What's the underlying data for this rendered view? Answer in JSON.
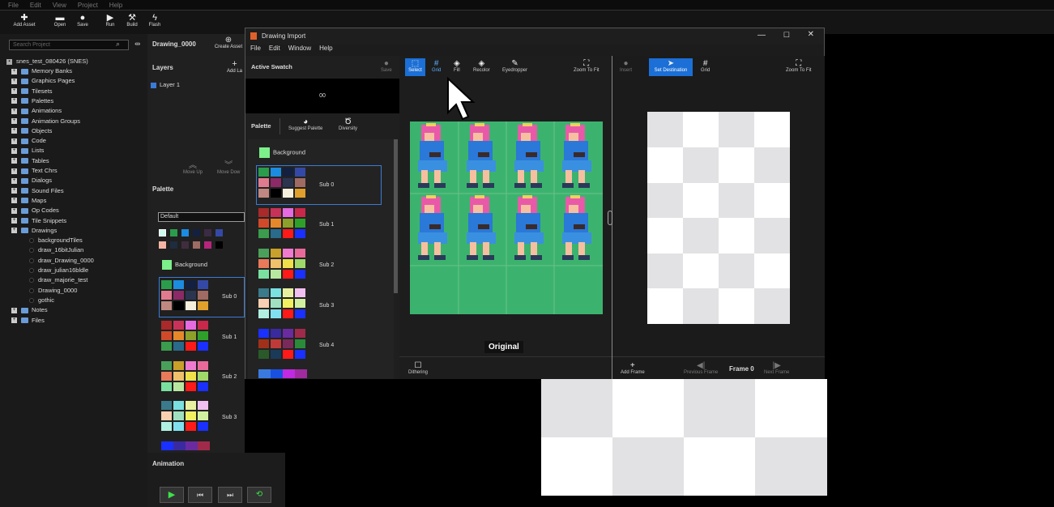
{
  "menubar": [
    "File",
    "Edit",
    "View",
    "Project",
    "Help"
  ],
  "toolbar": [
    {
      "label": "Add Asset",
      "icon": "plus-icon"
    },
    {
      "label": "Open",
      "icon": "folder-icon"
    },
    {
      "label": "Save",
      "icon": "save-icon"
    },
    {
      "label": "Run",
      "icon": "play-icon"
    },
    {
      "label": "Build",
      "icon": "hammer-icon"
    },
    {
      "label": "Flash",
      "icon": "bolt-icon"
    }
  ],
  "search_placeholder": "Search Project",
  "project": "snes_test_080426 (SNES)",
  "tree": [
    "Memory Banks",
    "Graphics Pages",
    "Tilesets",
    "Palettes",
    "Animations",
    "Animation Groups",
    "Objects",
    "Code",
    "Lists",
    "Tables",
    "Text Chrs",
    "Dialogs",
    "Sound Files",
    "Maps",
    "Op Codes",
    "Tile Snippets",
    "Drawings"
  ],
  "drawings": [
    "backgroundTiles",
    "draw_16bitJulian",
    "draw_Drawing_0000",
    "draw_julian16bldle",
    "draw_majorie_test",
    "Drawing_0000",
    "gothic"
  ],
  "tree_tail": [
    "Notes",
    "Files"
  ],
  "doc_tab": "Drawing_0000",
  "create_asset": "Create Asset",
  "layers_title": "Layers",
  "add_layer": "Add La",
  "layer1": "Layer 1",
  "move_up": "Move Up",
  "move_down": "Move Dow",
  "palette_title": "Palette",
  "palette_select": "Default",
  "background_label": "Background",
  "subs": [
    "Sub 0",
    "Sub 1",
    "Sub 2",
    "Sub 3",
    "Sub 4"
  ],
  "animation_title": "Animation",
  "window_title": "Drawing Import",
  "window_menu": [
    "File",
    "Edit",
    "Window",
    "Help"
  ],
  "active_swatch": "Active Swatch",
  "save": "Save",
  "swatch_value": "00",
  "palette2": "Palette",
  "suggest_palette": "Suggest Palette",
  "diversity": "Diversity",
  "tools_left": [
    "Select",
    "Grid",
    "Fill",
    "Recolor",
    "Eyedropper"
  ],
  "zoom_to_fit": "Zoom To Fit",
  "insert": "Insert",
  "set_destination": "Set Destination",
  "grid": "Grid",
  "original": "Original",
  "dithering": "Dithering",
  "add_frame": "Add Frame",
  "previous_frame": "Previous Frame",
  "frame_label": "Frame 0",
  "next_frame": "Next Frame",
  "colors": {
    "accent": "#1b6fd6",
    "sprite_bg": "#3bb36e",
    "bg_swatch": "#7cf08a"
  }
}
